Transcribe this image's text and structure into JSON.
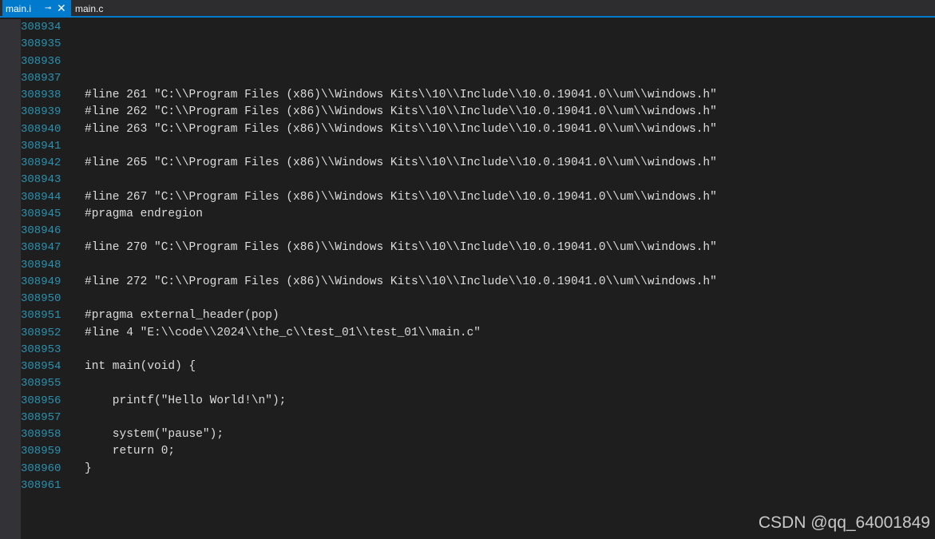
{
  "tabs": [
    {
      "label": "main.i",
      "pin": "⊸",
      "close": "✕"
    },
    {
      "label": "main.c"
    }
  ],
  "lines": [
    {
      "number": "308934",
      "text": ""
    },
    {
      "number": "308935",
      "text": ""
    },
    {
      "number": "308936",
      "text": ""
    },
    {
      "number": "308937",
      "text": ""
    },
    {
      "number": "308938",
      "text": "#line 261 \"C:\\\\Program Files (x86)\\\\Windows Kits\\\\10\\\\Include\\\\10.0.19041.0\\\\um\\\\windows.h\""
    },
    {
      "number": "308939",
      "text": "#line 262 \"C:\\\\Program Files (x86)\\\\Windows Kits\\\\10\\\\Include\\\\10.0.19041.0\\\\um\\\\windows.h\""
    },
    {
      "number": "308940",
      "text": "#line 263 \"C:\\\\Program Files (x86)\\\\Windows Kits\\\\10\\\\Include\\\\10.0.19041.0\\\\um\\\\windows.h\""
    },
    {
      "number": "308941",
      "text": ""
    },
    {
      "number": "308942",
      "text": "#line 265 \"C:\\\\Program Files (x86)\\\\Windows Kits\\\\10\\\\Include\\\\10.0.19041.0\\\\um\\\\windows.h\""
    },
    {
      "number": "308943",
      "text": ""
    },
    {
      "number": "308944",
      "text": "#line 267 \"C:\\\\Program Files (x86)\\\\Windows Kits\\\\10\\\\Include\\\\10.0.19041.0\\\\um\\\\windows.h\""
    },
    {
      "number": "308945",
      "text": "#pragma endregion"
    },
    {
      "number": "308946",
      "text": ""
    },
    {
      "number": "308947",
      "text": "#line 270 \"C:\\\\Program Files (x86)\\\\Windows Kits\\\\10\\\\Include\\\\10.0.19041.0\\\\um\\\\windows.h\""
    },
    {
      "number": "308948",
      "text": ""
    },
    {
      "number": "308949",
      "text": "#line 272 \"C:\\\\Program Files (x86)\\\\Windows Kits\\\\10\\\\Include\\\\10.0.19041.0\\\\um\\\\windows.h\""
    },
    {
      "number": "308950",
      "text": ""
    },
    {
      "number": "308951",
      "text": "#pragma external_header(pop)"
    },
    {
      "number": "308952",
      "text": "#line 4 \"E:\\\\code\\\\2024\\\\the_c\\\\test_01\\\\test_01\\\\main.c\""
    },
    {
      "number": "308953",
      "text": ""
    },
    {
      "number": "308954",
      "text": "int main(void) {"
    },
    {
      "number": "308955",
      "text": ""
    },
    {
      "number": "308956",
      "text": "    printf(\"Hello World!\\n\");"
    },
    {
      "number": "308957",
      "text": ""
    },
    {
      "number": "308958",
      "text": "    system(\"pause\");"
    },
    {
      "number": "308959",
      "text": "    return 0;"
    },
    {
      "number": "308960",
      "text": "}"
    },
    {
      "number": "308961",
      "text": ""
    }
  ],
  "watermark": "CSDN @qq_64001849",
  "colors": {
    "background": "#1e1e1e",
    "line_number": "#2b91af",
    "code_text": "#dcdcdc",
    "accent": "#007acc"
  }
}
